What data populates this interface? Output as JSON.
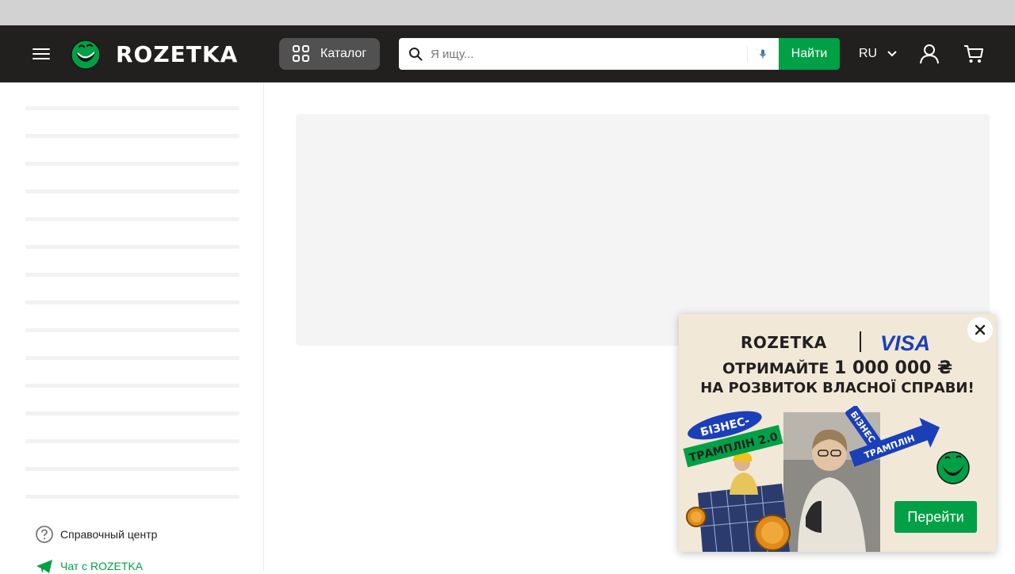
{
  "header": {
    "logo_text": "ROZETKA",
    "catalog_label": "Каталог",
    "search_placeholder": "Я ищу...",
    "search_button": "Найти",
    "language": "RU"
  },
  "sidebar": {
    "help_center": "Справочный центр",
    "chat": "Чат с ROZETKA"
  },
  "promo": {
    "brand_left": "ROZETKA",
    "brand_right": "VISA",
    "headline_line1_prefix": "ОТРИМАЙТЕ",
    "headline_amount": "1 000 000 ₴",
    "headline_line2": "НА РОЗВИТОК ВЛАСНОЇ СПРАВИ!",
    "ribbon_left_top": "БІЗНЕС-",
    "ribbon_left_bottom": "ТРАМПЛІН 2.0",
    "ribbon_right_top": "БІЗНЕС",
    "ribbon_right_bottom": "ТРАМПЛІН",
    "cta_button": "Перейти"
  },
  "colors": {
    "header_bg": "#221f1f",
    "brand_green": "#00a046",
    "catalog_bg": "#525151",
    "promo_bg": "#f2e8d7",
    "visa_blue": "#1a3fb8"
  }
}
